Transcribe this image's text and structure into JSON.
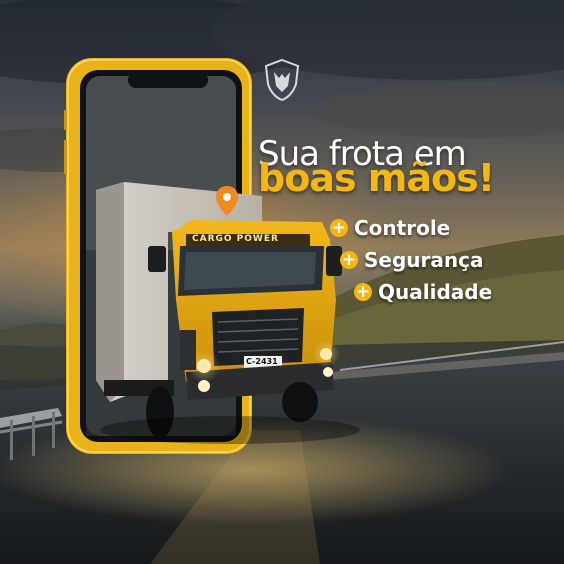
{
  "headline": {
    "line1": "Sua frota em",
    "line2": "boas mãos!"
  },
  "features": [
    {
      "label": "Controle",
      "icon": "plus-icon"
    },
    {
      "label": "Segurança",
      "icon": "plus-icon"
    },
    {
      "label": "Qualidade",
      "icon": "plus-icon"
    }
  ],
  "truck": {
    "brand_text": "CARGO POWER",
    "plate": "C-2431"
  },
  "colors": {
    "accent": "#f4b70e",
    "phone": "#e8b21a",
    "text": "#ffffff"
  },
  "icons": [
    "wolf-logo-icon",
    "location-pin-icon",
    "plus-icon"
  ]
}
